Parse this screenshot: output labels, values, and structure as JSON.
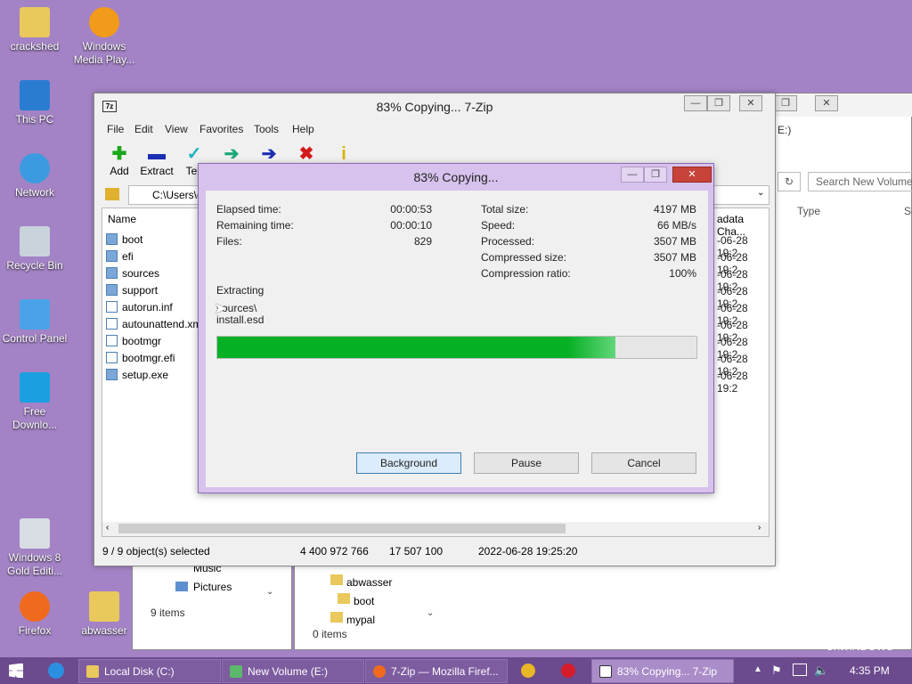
{
  "desktop": {
    "icons": [
      {
        "label": "crackshed"
      },
      {
        "label": "Windows Media Play..."
      },
      {
        "label": "This PC"
      },
      {
        "label": "Network"
      },
      {
        "label": "Recycle Bin"
      },
      {
        "label": "Control Panel"
      },
      {
        "label": "Free Downlo..."
      },
      {
        "label": "Windows 8 Gold Editi..."
      },
      {
        "label": "Firefox"
      },
      {
        "label": "abwasser"
      }
    ]
  },
  "bg_explorer_left": {
    "items": [
      "Music",
      "Pictures"
    ],
    "count": "9 items"
  },
  "bg_explorer_right": {
    "search_placeholder": "Search New Volume",
    "drive_label": "E:)",
    "col_type": "Type",
    "col_size": "Si",
    "tree": [
      "abwasser",
      "boot",
      "mypal"
    ],
    "count": "0 items",
    "footer": "C:\\WINDOWS"
  },
  "zip": {
    "title": "83% Copying... 7-Zip",
    "menu": [
      "File",
      "Edit",
      "View",
      "Favorites",
      "Tools",
      "Help"
    ],
    "toolbar": [
      {
        "label": "Add",
        "glyph": "✚",
        "color": "#1aa81a"
      },
      {
        "label": "Extract",
        "glyph": "▬",
        "color": "#1b2fb3"
      },
      {
        "label": "Tes",
        "glyph": "✓",
        "color": "#1bb3c0"
      },
      {
        "label": "",
        "glyph": "➔",
        "color": "#1aa87a"
      },
      {
        "label": "",
        "glyph": "➔",
        "color": "#1b2fb3"
      },
      {
        "label": "",
        "glyph": "✖",
        "color": "#d21b1b"
      },
      {
        "label": "",
        "glyph": "i",
        "color": "#d8b400"
      }
    ],
    "path": "C:\\Users\\c",
    "col_name": "Name",
    "col_modified": "adata Cha...",
    "files": [
      {
        "name": "boot",
        "date": "-06-28 19:2"
      },
      {
        "name": "efi",
        "date": "-06-28 19:2"
      },
      {
        "name": "sources",
        "date": "-06-28 19:2"
      },
      {
        "name": "support",
        "date": "-06-28 19:2"
      },
      {
        "name": "autorun.inf",
        "date": "-06-28 19:2"
      },
      {
        "name": "autounattend.xm",
        "date": "-06-28 19:2"
      },
      {
        "name": "bootmgr",
        "date": "-06-28 19:2"
      },
      {
        "name": "bootmgr.efi",
        "date": "-06-28 19:2"
      },
      {
        "name": "setup.exe",
        "date": "-06-28 19:2"
      }
    ],
    "status": {
      "selected": "9 / 9 object(s) selected",
      "size": "4 400 972 766",
      "packed": "17 507 100",
      "date": "2022-06-28 19:25:20"
    }
  },
  "dialog": {
    "title": "83% Copying...",
    "elapsed_label": "Elapsed time:",
    "elapsed": "00:00:53",
    "remaining_label": "Remaining time:",
    "remaining": "00:00:10",
    "files_label": "Files:",
    "files": "829",
    "total_label": "Total size:",
    "total": "4197 MB",
    "speed_label": "Speed:",
    "speed": "66 MB/s",
    "processed_label": "Processed:",
    "processed": "3507 MB",
    "compressed_label": "Compressed size:",
    "compressed": "3507 MB",
    "ratio_label": "Compression ratio:",
    "ratio": "100%",
    "action": "Extracting",
    "file_line1": "sources\\",
    "file_line2": "install.esd",
    "progress": 0.83,
    "progress_color": "#06b025",
    "buttons": {
      "background": "Background",
      "pause": "Pause",
      "cancel": "Cancel"
    }
  },
  "taskbar": {
    "items": [
      {
        "label": "Local Disk (C:)"
      },
      {
        "label": "New Volume (E:)"
      },
      {
        "label": "7-Zip — Mozilla Firef..."
      },
      {
        "label": "83% Copying... 7-Zip"
      }
    ],
    "clock": "4:35 PM"
  }
}
